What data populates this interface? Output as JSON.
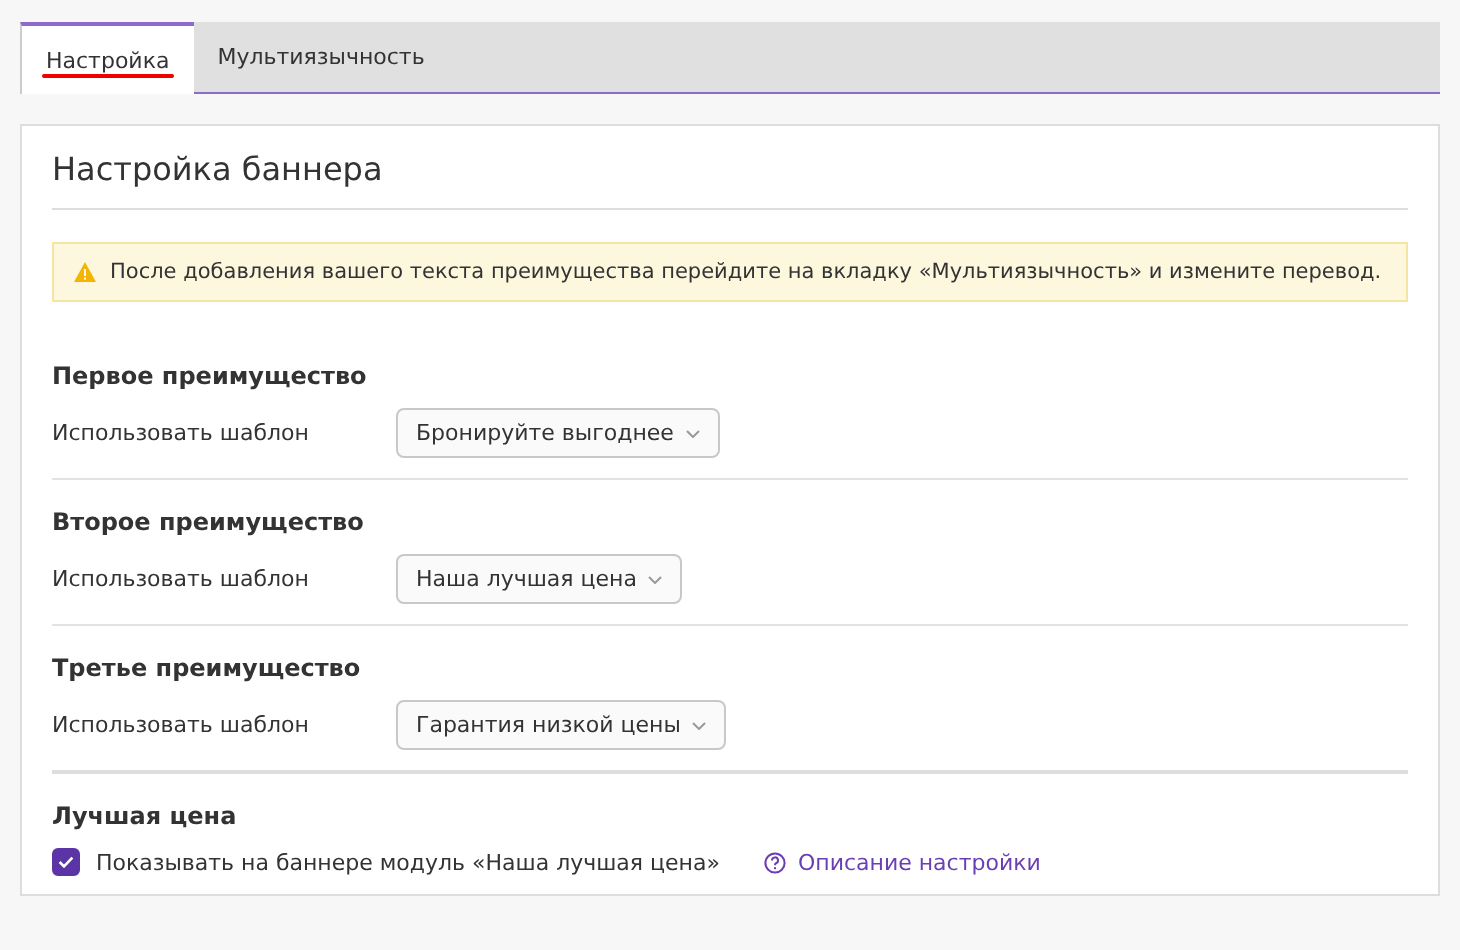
{
  "tabs": [
    {
      "label": "Настройка",
      "selected": true
    },
    {
      "label": "Мультиязычность",
      "selected": false
    }
  ],
  "panel": {
    "title": "Настройка баннера",
    "alert": "После добавления вашего текста преимущества перейдите на вкладку «Мультиязычность» и измените перевод.",
    "sections": [
      {
        "kind": "select",
        "heading": "Первое преимущество",
        "label": "Использовать шаблон",
        "value": "Бронируйте выгоднее"
      },
      {
        "kind": "select",
        "heading": "Второе преимущество",
        "label": "Использовать шаблон",
        "value": "Наша лучшая цена"
      },
      {
        "kind": "select",
        "heading": "Третье преимущество",
        "label": "Использовать шаблон",
        "value": "Гарантия низкой цены"
      },
      {
        "kind": "checkbox",
        "heading": "Лучшая цена",
        "label": "Показывать на баннере модуль «Наша лучшая цена»",
        "checked": true,
        "help": "Описание настройки"
      }
    ]
  }
}
